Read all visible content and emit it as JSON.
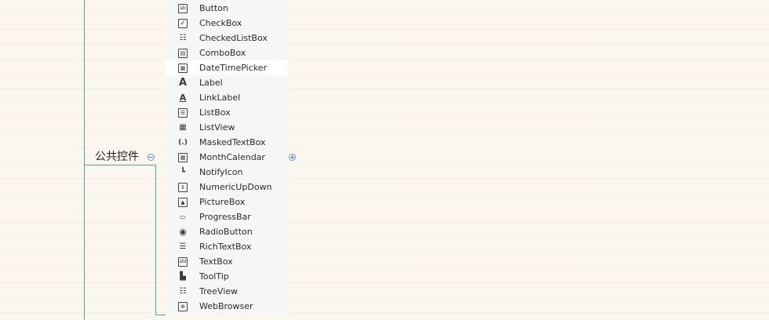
{
  "mindmap": {
    "root_topic": "公共控件",
    "colors": {
      "connector": "#5e9f93",
      "expand_button": "#4a73b8"
    },
    "items": [
      {
        "label": "Button",
        "icon": "button-icon"
      },
      {
        "label": "CheckBox",
        "icon": "checkbox-icon"
      },
      {
        "label": "CheckedListBox",
        "icon": "checkedlistbox-icon"
      },
      {
        "label": "ComboBox",
        "icon": "combobox-icon"
      },
      {
        "label": "DateTimePicker",
        "icon": "datetimepicker-icon"
      },
      {
        "label": "Label",
        "icon": "label-icon"
      },
      {
        "label": "LinkLabel",
        "icon": "linklabel-icon"
      },
      {
        "label": "ListBox",
        "icon": "listbox-icon"
      },
      {
        "label": "ListView",
        "icon": "listview-icon"
      },
      {
        "label": "MaskedTextBox",
        "icon": "maskedtextbox-icon"
      },
      {
        "label": "MonthCalendar",
        "icon": "monthcalendar-icon"
      },
      {
        "label": "NotifyIcon",
        "icon": "notifyicon-icon"
      },
      {
        "label": "NumericUpDown",
        "icon": "numericupdown-icon"
      },
      {
        "label": "PictureBox",
        "icon": "picturebox-icon"
      },
      {
        "label": "ProgressBar",
        "icon": "progressbar-icon"
      },
      {
        "label": "RadioButton",
        "icon": "radiobutton-icon"
      },
      {
        "label": "RichTextBox",
        "icon": "richtextbox-icon"
      },
      {
        "label": "TextBox",
        "icon": "textbox-icon"
      },
      {
        "label": "ToolTip",
        "icon": "tooltip-icon"
      },
      {
        "label": "TreeView",
        "icon": "treeview-icon"
      },
      {
        "label": "WebBrowser",
        "icon": "webbrowser-icon"
      }
    ]
  }
}
